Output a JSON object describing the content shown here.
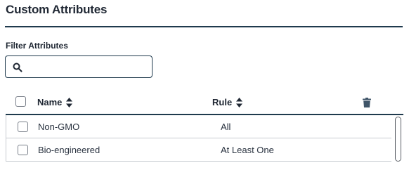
{
  "page": {
    "title": "Custom Attributes"
  },
  "filter": {
    "label": "Filter Attributes",
    "placeholder": "",
    "value": ""
  },
  "table": {
    "columns": {
      "name": "Name",
      "rule": "Rule"
    },
    "rows": [
      {
        "name": "Non-GMO",
        "rule": "All",
        "checked": false
      },
      {
        "name": "Bio-engineered",
        "rule": "At Least One",
        "checked": false
      }
    ]
  },
  "colors": {
    "accent": "#1f3a4d",
    "text": "#1f2733",
    "trash": "#3f5568",
    "divider": "#c7cbd1"
  },
  "icons": {
    "search": "search-icon",
    "sort": "sort-icon",
    "delete": "trash-icon"
  }
}
